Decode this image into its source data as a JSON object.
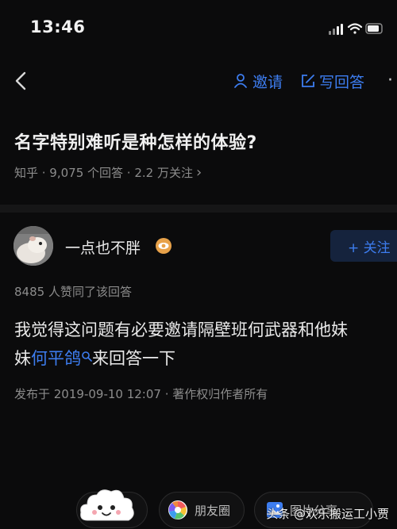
{
  "status_bar": {
    "time": "13:46"
  },
  "nav": {
    "invite_label": "邀请",
    "write_label": "写回答",
    "more_glyph": "·"
  },
  "question": {
    "title": "名字特别难听是种怎样的体验?",
    "meta": "知乎 · 9,075 个回答 · 2.2 万关注",
    "meta_arrow": "›"
  },
  "answer": {
    "author_name": "一点也不胖",
    "follow_label": "+ 关注",
    "likes_text": "8485 人赞同了该回答",
    "line1": "我觉得这问题有必要邀请隔壁班何武器和他妹",
    "line2_prefix": "妹",
    "line2_link": "何平鸽",
    "line2_suffix": "来回答一下",
    "posted": "发布于 2019-09-10 12:07 · 著作权归作者所有"
  },
  "share": {
    "moments_label": "朋友圈",
    "image_label": "图片分享"
  },
  "watermark": "头条 @欢乐搬运工小贾",
  "colors": {
    "accent": "#3d7df0",
    "background": "#0b0b0c",
    "muted_text": "#8c8c8c"
  }
}
